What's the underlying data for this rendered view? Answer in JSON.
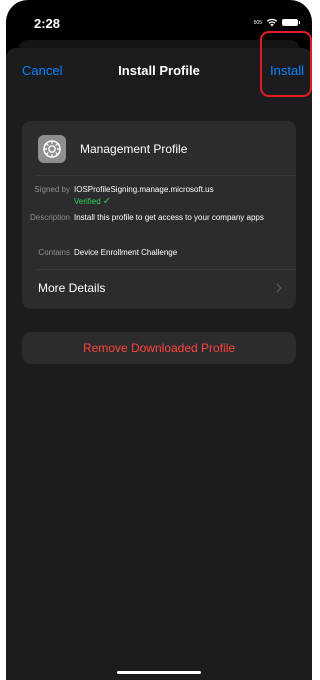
{
  "status_bar": {
    "time": "2:28",
    "carrier": "505"
  },
  "nav": {
    "cancel_label": "Cancel",
    "title": "Install Profile",
    "install_label": "Install"
  },
  "profile": {
    "name": "Management Profile",
    "signed_by_label": "Signed by",
    "signed_by_value": "IOSProfileSigning.manage.microsoft.us",
    "verified_label": "Verified",
    "verified_mark": "✓",
    "description_label": "Description",
    "description_value": "Install this profile to get access to your company apps",
    "contains_label": "Contains",
    "contains_value": "Device Enrollment Challenge",
    "more_details_label": "More Details"
  },
  "actions": {
    "remove_label": "Remove Downloaded Profile"
  },
  "colors": {
    "accent": "#0a84ff",
    "destructive": "#ff453a",
    "verified": "#30d158",
    "highlight": "#e31b23"
  },
  "icons": {
    "profile_icon": "gear-icon",
    "more_details_icon": "chevron-right-icon",
    "verified_icon": "check-icon"
  }
}
